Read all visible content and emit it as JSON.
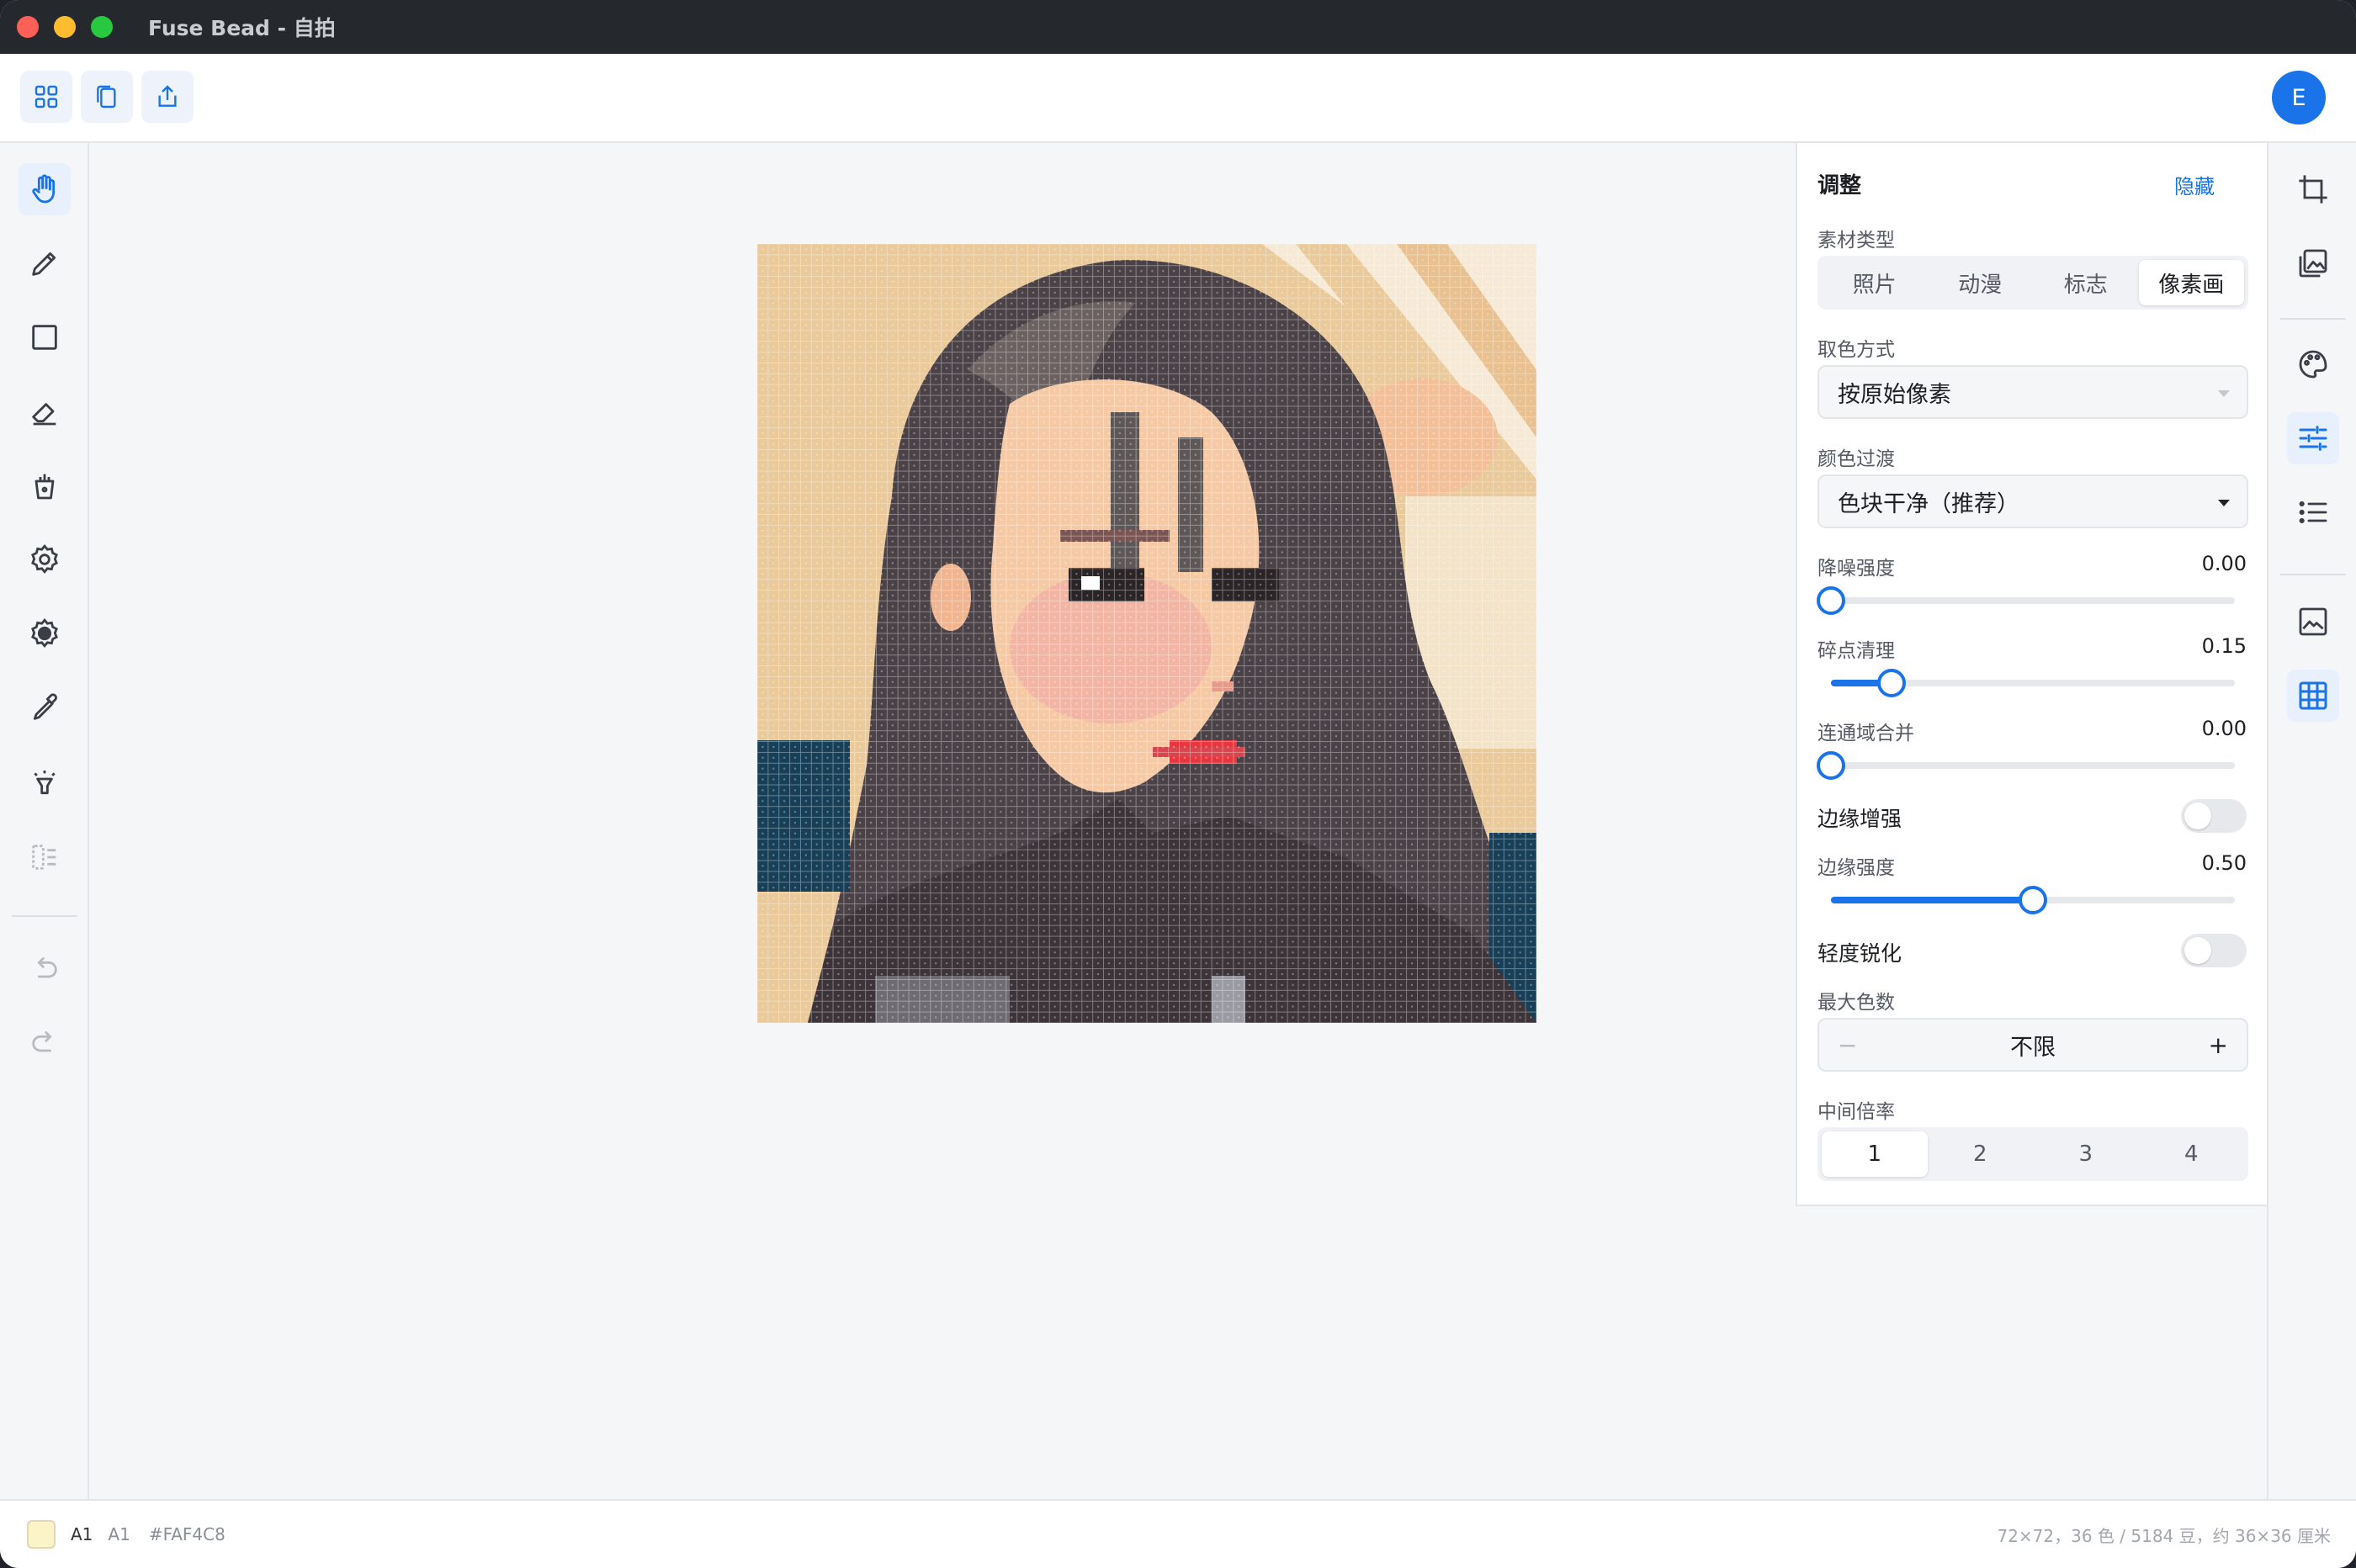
{
  "window": {
    "title": "Fuse Bead - 自拍"
  },
  "toolbar": {
    "buttons": [
      "grid-view-icon",
      "copy-icon",
      "share-icon"
    ],
    "avatar_letter": "E"
  },
  "left_tools": [
    "hand-icon",
    "pencil-icon",
    "rectangle-icon",
    "eraser-icon",
    "bucket-icon",
    "gear-icon",
    "gear-filled-icon",
    "eyedropper-icon",
    "highlight-icon",
    "replace-icon",
    "undo-icon",
    "redo-icon"
  ],
  "right_tools": [
    "crop-icon",
    "image-stack-icon",
    "palette-icon",
    "sliders-icon",
    "list-icon",
    "image-icon",
    "grid-icon"
  ],
  "panel": {
    "title": "调整",
    "hide_label": "隐藏",
    "material": {
      "label": "素材类型",
      "options": [
        "照片",
        "动漫",
        "标志",
        "像素画"
      ],
      "selected": "像素画"
    },
    "color_pick": {
      "label": "取色方式",
      "value": "按原始像素"
    },
    "color_transition": {
      "label": "颜色过渡",
      "value": "色块干净（推荐）"
    },
    "denoise": {
      "label": "降噪强度",
      "value": "0.00",
      "level": 0.0
    },
    "speckle": {
      "label": "碎点清理",
      "value": "0.15",
      "level": 0.15
    },
    "merge": {
      "label": "连通域合并",
      "value": "0.00",
      "level": 0.0
    },
    "edge_enhance": {
      "label": "边缘增强",
      "on": false
    },
    "edge_strength": {
      "label": "边缘强度",
      "value": "0.50",
      "level": 0.5
    },
    "sharpen": {
      "label": "轻度锐化",
      "on": false
    },
    "max_colors": {
      "label": "最大色数",
      "value": "不限",
      "minus": "−",
      "plus": "+"
    },
    "scale": {
      "label": "中间倍率",
      "options": [
        "1",
        "2",
        "3",
        "4"
      ],
      "selected": "1"
    }
  },
  "status": {
    "swatch_color": "#FAF4C8",
    "code": "A1",
    "code2": "A1",
    "hex": "#FAF4C8",
    "info": "72×72，36 色 / 5184 豆，约 36×36 厘米"
  },
  "colors": {
    "accent": "#1a73e8",
    "panel_bg": "#ffffff",
    "canvas_bg": "#f5f6f8"
  }
}
